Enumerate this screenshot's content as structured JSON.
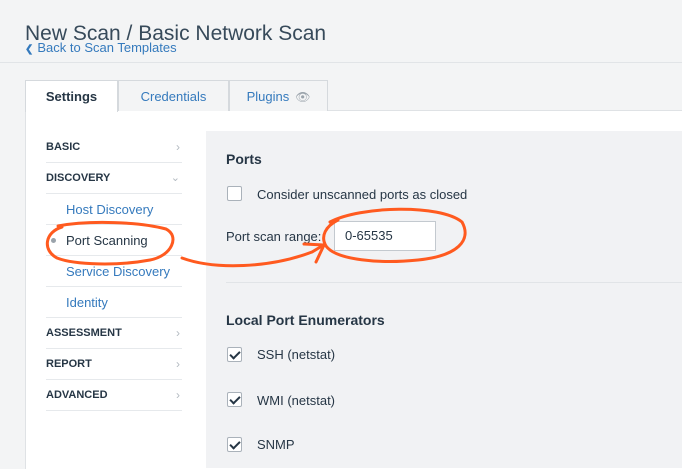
{
  "header": {
    "title": "New Scan / Basic Network Scan",
    "back_link": "Back to Scan Templates"
  },
  "tabs": [
    {
      "label": "Settings",
      "active": true
    },
    {
      "label": "Credentials",
      "active": false
    },
    {
      "label": "Plugins",
      "active": false,
      "icon": "eye-icon"
    }
  ],
  "sidebar": {
    "items": [
      {
        "label": "BASIC",
        "icon": "chevron-right-icon"
      },
      {
        "label": "DISCOVERY",
        "icon": "chevron-down-icon",
        "expanded": true
      },
      {
        "label": "Host Discovery"
      },
      {
        "label": "Port Scanning",
        "selected": true
      },
      {
        "label": "Service Discovery"
      },
      {
        "label": "Identity"
      },
      {
        "label": "ASSESSMENT",
        "icon": "chevron-right-icon"
      },
      {
        "label": "REPORT",
        "icon": "chevron-right-icon"
      },
      {
        "label": "ADVANCED",
        "icon": "chevron-right-icon"
      }
    ]
  },
  "ports": {
    "heading": "Ports",
    "unscanned_closed": {
      "label": "Consider unscanned ports as closed",
      "checked": false
    },
    "range": {
      "label": "Port scan range:",
      "value": "0-65535"
    }
  },
  "enumerators": {
    "heading": "Local Port Enumerators",
    "items": [
      {
        "label": "SSH (netstat)",
        "checked": true
      },
      {
        "label": "WMI (netstat)",
        "checked": true
      },
      {
        "label": "SNMP",
        "checked": true
      }
    ]
  },
  "colors": {
    "link": "#357abd",
    "annotation": "#ff5a1f"
  }
}
